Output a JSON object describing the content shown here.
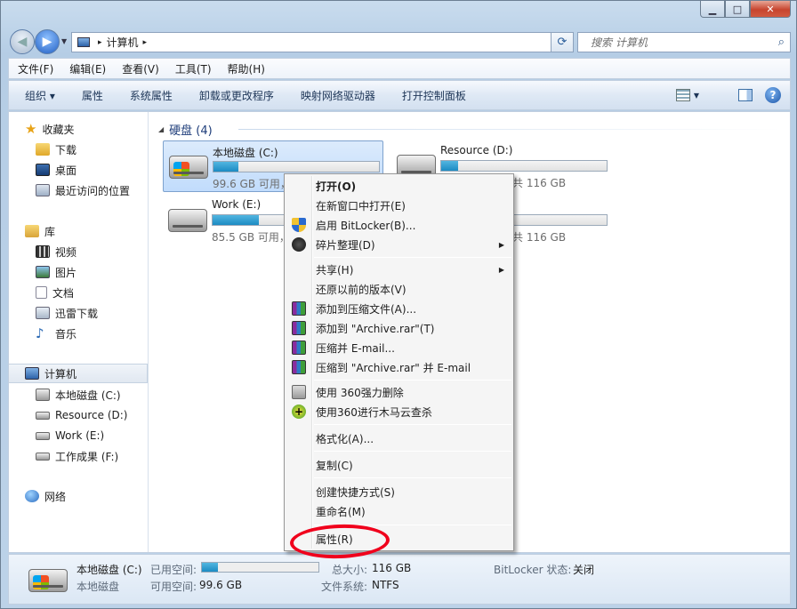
{
  "titlebar": {
    "min": "▁",
    "max": "□",
    "close": "✕"
  },
  "address": {
    "crumb": "计算机",
    "sep": "▸"
  },
  "search": {
    "placeholder": "搜索 计算机"
  },
  "menubar": [
    "文件(F)",
    "编辑(E)",
    "查看(V)",
    "工具(T)",
    "帮助(H)"
  ],
  "commandbar": [
    "组织 ▾",
    "属性",
    "系统属性",
    "卸载或更改程序",
    "映射网络驱动器",
    "打开控制面板"
  ],
  "sidebar": {
    "favorites": "收藏夹",
    "fav_items": [
      "下载",
      "桌面",
      "最近访问的位置"
    ],
    "libraries": "库",
    "lib_items": [
      "视频",
      "图片",
      "文档",
      "迅雷下载",
      "音乐"
    ],
    "computer": "计算机",
    "drives": [
      "本地磁盘 (C:)",
      "Resource (D:)",
      "Work (E:)",
      "工作成果 (F:)"
    ],
    "network": "网络"
  },
  "group_header": "硬盘 (4)",
  "drives": [
    {
      "name": "本地磁盘 (C:)",
      "free": "99.6 GB 可用，",
      "fill_pct": 15
    },
    {
      "name": "Resource (D:)",
      "free": "共 116 GB",
      "fill_pct": 10
    },
    {
      "name": "Work (E:)",
      "free": "85.5 GB 可用，",
      "fill_pct": 28
    },
    {
      "name": "",
      "free": "共 116 GB",
      "fill_pct": 0
    }
  ],
  "context_menu": {
    "open": "打开(O)",
    "open_new": "在新窗口中打开(E)",
    "bitlocker": "启用 BitLocker(B)...",
    "defrag": "碎片整理(D)",
    "share": "共享(H)",
    "restore": "还原以前的版本(V)",
    "add_archive": "添加到压缩文件(A)...",
    "add_rar": "添加到 \"Archive.rar\"(T)",
    "zip_email": "压缩并 E-mail...",
    "rar_email": "压缩到 \"Archive.rar\" 并 E-mail",
    "del360": "使用 360强力删除",
    "scan360": "使用360进行木马云查杀",
    "format": "格式化(A)...",
    "copy": "复制(C)",
    "shortcut": "创建快捷方式(S)",
    "rename": "重命名(M)",
    "properties": "属性(R)"
  },
  "status": {
    "name": "本地磁盘 (C:)",
    "type": "本地磁盘",
    "used_label": "已用空间:",
    "free_label": "可用空间:",
    "free_value": "99.6 GB",
    "total_label": "总大小:",
    "total_value": "116 GB",
    "fs_label": "文件系统:",
    "fs_value": "NTFS",
    "bitlocker_label": "BitLocker 状态:",
    "bitlocker_value": "关闭",
    "used_pct": 14
  },
  "colors": {
    "accent": "#1c8bc3",
    "annotation": "#f0001c"
  }
}
